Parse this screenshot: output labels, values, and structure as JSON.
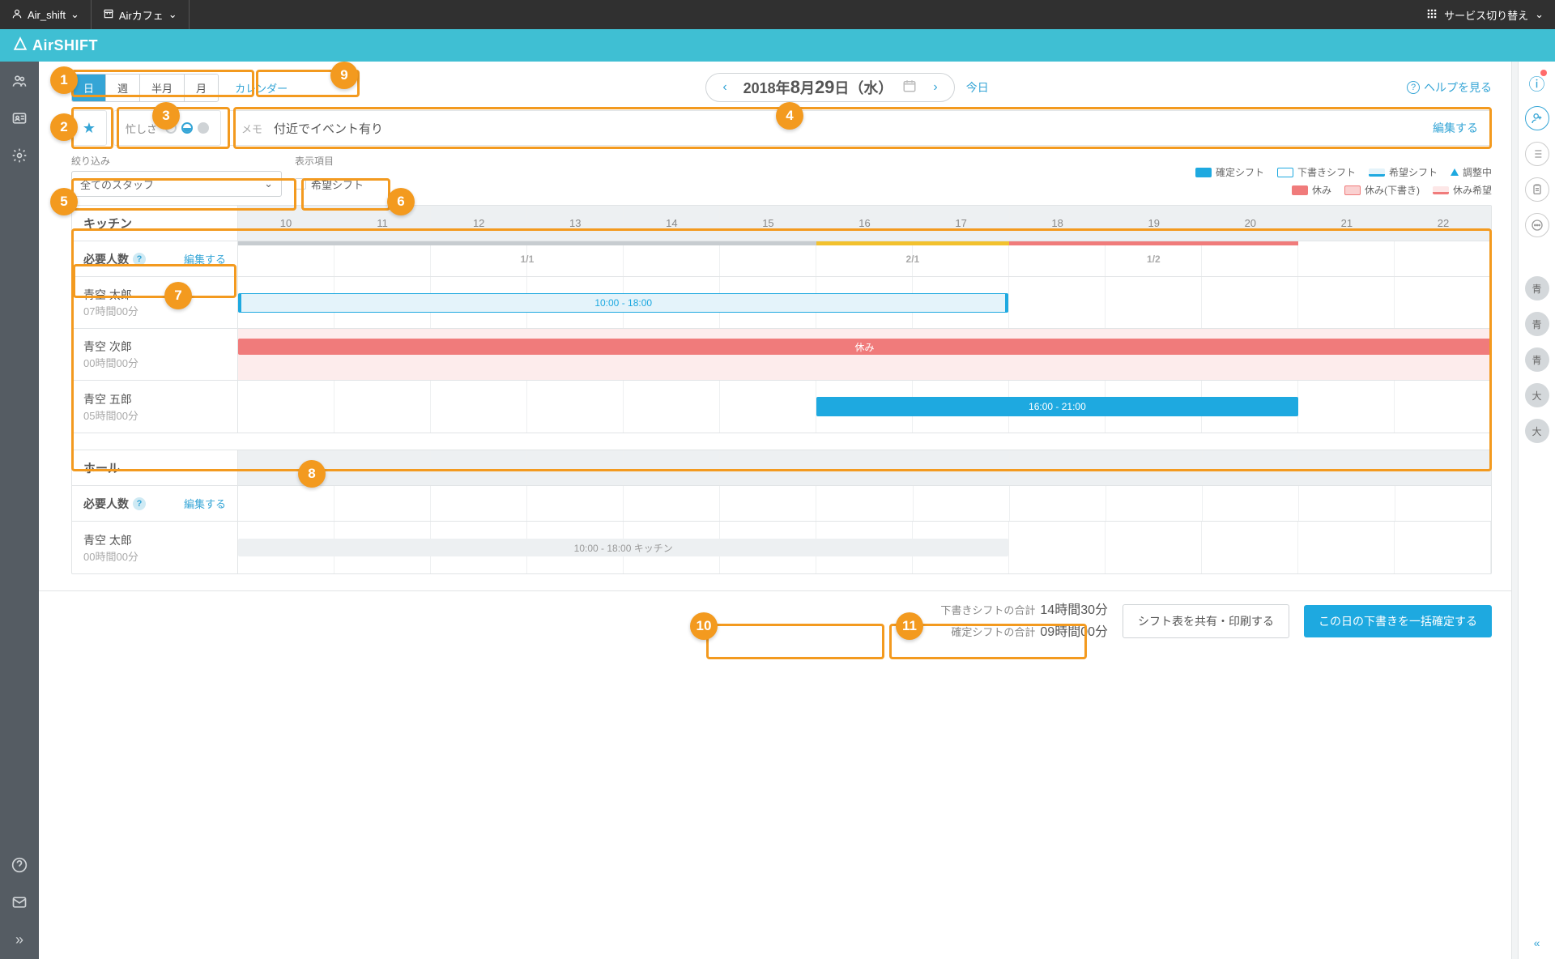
{
  "topbar": {
    "user": "Air_shift",
    "store": "Airカフェ",
    "service_switch": "サービス切り替え"
  },
  "brand": "AirSHIFT",
  "header": {
    "views": {
      "day": "日",
      "week": "週",
      "halfmonth": "半月",
      "month": "月"
    },
    "calendar_link": "カレンダー",
    "date_text_prefix": "2018年",
    "date_month": "8",
    "date_month_suffix": "月",
    "date_day": "29",
    "date_day_suffix": "日",
    "date_weekday": "（水）",
    "today": "今日",
    "help": "ヘルプを見る"
  },
  "info": {
    "busy_label": "忙しさ",
    "memo_label": "メモ",
    "memo_text": "付近でイベント有り",
    "memo_edit": "編集する"
  },
  "filters": {
    "filter_label": "絞り込み",
    "filter_value": "全てのスタッフ",
    "display_label": "表示項目",
    "checkbox_label": "希望シフト"
  },
  "legend": {
    "confirmed": "確定シフト",
    "draft": "下書きシフト",
    "wish": "希望シフト",
    "adjust": "調整中",
    "rest": "休み",
    "rest_draft": "休み(下書き)",
    "rest_wish": "休み希望"
  },
  "hours": [
    "10",
    "11",
    "12",
    "13",
    "14",
    "15",
    "16",
    "17",
    "18",
    "19",
    "20",
    "21",
    "22"
  ],
  "section1": {
    "title": "キッチン",
    "req_title": "必要人数",
    "req_edit": "編集する",
    "req_cells": [
      "1/1",
      "2/1",
      "1/2"
    ],
    "staff": [
      {
        "name": "青空 太郎",
        "hours": "07時間00分",
        "bar_text": "10:00 - 18:00",
        "bar_type": "draft",
        "bar_left_pct": 0,
        "bar_width_pct": 61.5
      },
      {
        "name": "青空 次郎",
        "hours": "00時間00分",
        "bar_text": "休み",
        "bar_type": "rest"
      },
      {
        "name": "青空 五郎",
        "hours": "05時間00分",
        "bar_text": "16:00 - 21:00",
        "bar_type": "confirmed",
        "bar_left_pct": 46.15,
        "bar_width_pct": 38.46
      }
    ]
  },
  "section2": {
    "title": "ホール",
    "req_title": "必要人数",
    "req_edit": "編集する",
    "staff": [
      {
        "name": "青空 太郎",
        "hours": "00時間00分",
        "bar_text": "10:00 - 18:00  キッチン",
        "bar_type": "wish",
        "bar_left_pct": 0,
        "bar_width_pct": 61.5
      }
    ]
  },
  "footer": {
    "draft_total_label": "下書きシフトの合計",
    "draft_total_value": "14時間30分",
    "conf_total_label": "確定シフトの合計",
    "conf_total_value": "09時間00分",
    "share_btn": "シフト表を共有・印刷する",
    "confirm_btn": "この日の下書きを一括確定する"
  },
  "right_avatars": [
    "青",
    "青",
    "青",
    "大",
    "大"
  ]
}
